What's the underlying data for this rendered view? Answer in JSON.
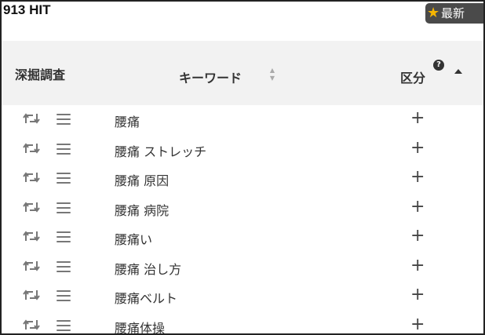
{
  "header": {
    "hit_count": "913 HIT",
    "latest_button_label": "最新"
  },
  "table": {
    "columns": {
      "deep_research": "深掘調査",
      "keyword": "キーワード",
      "category": "区分"
    },
    "help_icon_glyph": "?",
    "rows": [
      {
        "keyword": "腰痛",
        "action": "+"
      },
      {
        "keyword": "腰痛 ストレッチ",
        "action": "+"
      },
      {
        "keyword": "腰痛 原因",
        "action": "+"
      },
      {
        "keyword": "腰痛 病院",
        "action": "+"
      },
      {
        "keyword": "腰痛い",
        "action": "+"
      },
      {
        "keyword": "腰痛 治し方",
        "action": "+"
      },
      {
        "keyword": "腰痛ベルト",
        "action": "+"
      },
      {
        "keyword": "腰痛体操",
        "action": "+"
      }
    ]
  },
  "icons": {
    "latest": "star-icon",
    "row_deep": "retweet-icon",
    "row_menu": "menu-icon",
    "row_add": "plus-icon",
    "keyword_sort": "sort-icon",
    "category_sort": "caret-up-icon"
  },
  "colors": {
    "header_bg": "#f2f2f2",
    "button_bg": "#4a4a4a",
    "star": "#f5b400",
    "text": "#333333"
  }
}
